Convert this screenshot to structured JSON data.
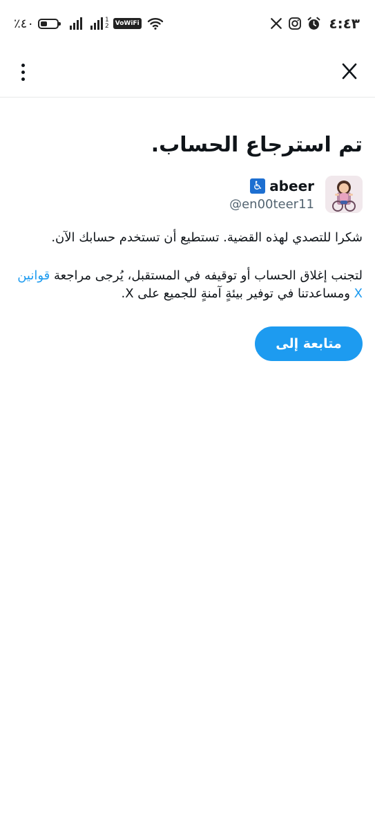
{
  "status_bar": {
    "time": "٤:٤٣",
    "battery_percent": "٪٤٠",
    "battery_level": 0.4,
    "vowifi_label": "VoWiFi",
    "sim_label": "1\n2",
    "icons": [
      "x-logo-icon",
      "instagram-icon",
      "alarm-icon",
      "wifi-icon",
      "signal-icon",
      "battery-icon"
    ]
  },
  "nav": {
    "close_icon": "close-icon",
    "menu_icon": "more-options-icon"
  },
  "main": {
    "title": "تم استرجاع الحساب.",
    "user": {
      "display_name": "abeer",
      "badge_emoji": "♿",
      "handle": "@en00teer11"
    },
    "message_1": "شكرا للتصدي لهذه القضية. تستطيع أن تستخدم حسابك الآن.",
    "message_2_before": "لتجنب إغلاق الحساب أو توقيفه في المستقبل، يُرجى مراجعة ",
    "message_2_link": "قوانين X",
    "message_2_after": " ومساعدتنا في توفير بيئةٍ آمنةٍ للجميع على X.",
    "continue_button": "متابعة إلى X"
  },
  "colors": {
    "accent": "#1d9bf0",
    "text": "#0f1419",
    "secondary_text": "#536471",
    "divider": "#e7e9ea"
  }
}
